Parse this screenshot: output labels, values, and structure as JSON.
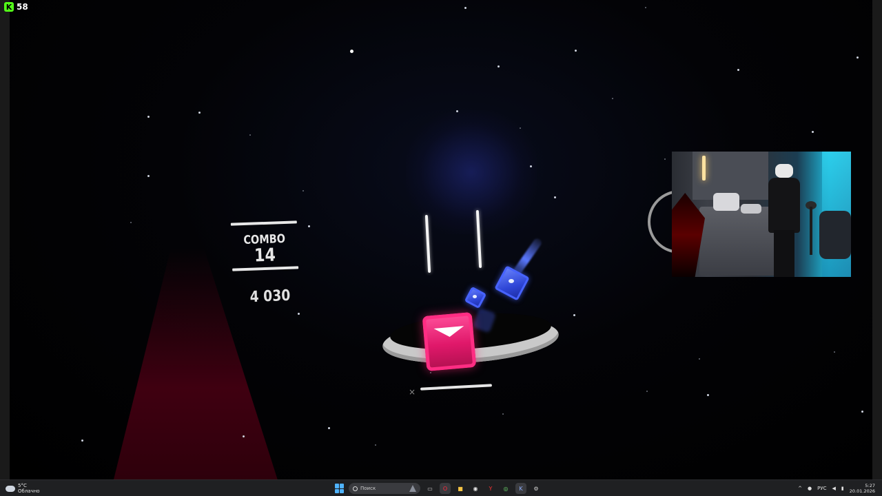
{
  "overlay": {
    "fps_value": "58",
    "fps_logo_icon": "kick-logo-icon"
  },
  "game": {
    "combo_label": "COMBO",
    "combo_value": "14",
    "score": "4 030",
    "note_colors": {
      "red": "#e0186a",
      "blue": "#2e45d6"
    },
    "fail_mark": "×"
  },
  "webcam": {
    "visible": true
  },
  "taskbar": {
    "weather": {
      "temp": "5°C",
      "desc": "Облачно",
      "icon": "cloud-icon"
    },
    "search_placeholder": "Поиск",
    "apps": [
      {
        "name": "file-explorer-icon",
        "glyph": "▭"
      },
      {
        "name": "opera-icon",
        "glyph": "O"
      },
      {
        "name": "folder-icon",
        "glyph": "■"
      },
      {
        "name": "chrome-icon",
        "glyph": "◉"
      },
      {
        "name": "yandex-icon",
        "glyph": "Y"
      },
      {
        "name": "xbox-icon",
        "glyph": "◎"
      },
      {
        "name": "kick-icon",
        "glyph": "K"
      },
      {
        "name": "settings-icon",
        "glyph": "⚙"
      }
    ],
    "tray": {
      "chevron": "^",
      "language": "РУС"
    },
    "clock": {
      "time": "5:27",
      "date": "20.01.2026"
    }
  }
}
